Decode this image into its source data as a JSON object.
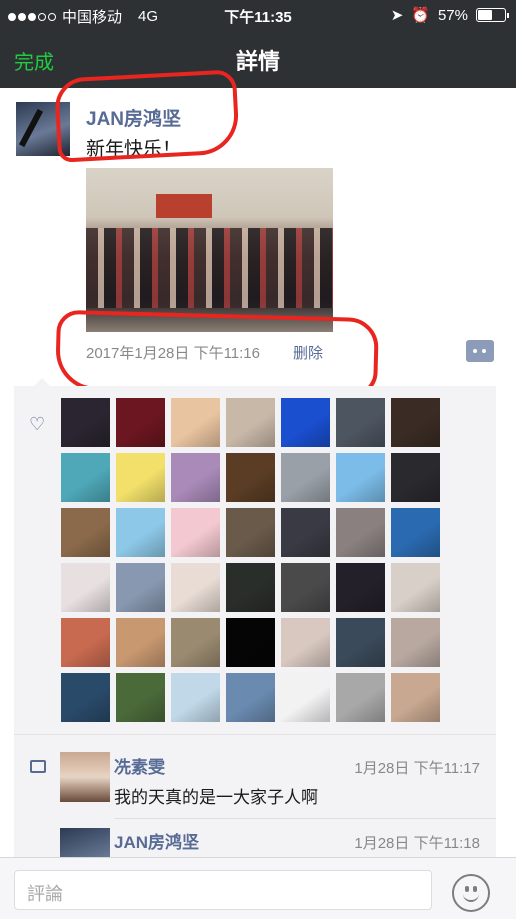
{
  "status_bar": {
    "carrier": "中国移动",
    "network": "4G",
    "time": "下午11:35",
    "battery": "57%",
    "battery_level": 0.57
  },
  "nav": {
    "done_label": "完成",
    "title": "詳情"
  },
  "post": {
    "author": "JAN房鸿坚",
    "text": "新年快乐！",
    "timestamp": "2017年1月28日 下午11:16",
    "delete_label": "删除"
  },
  "likes": {
    "icon": "heart-icon",
    "avatar_colors": [
      "#2a2530",
      "#6b1620",
      "#e9c4a0",
      "#c8b8a8",
      "#1a4fd0",
      "#4d5560",
      "#3a2c24",
      "#4ea8b8",
      "#f2e06a",
      "#a98ab8",
      "#5a3d24",
      "#9aa0a8",
      "#7bbce8",
      "#2a2a2e",
      "#8a6a4a",
      "#8dc8e8",
      "#f4c8d0",
      "#6a5a4a",
      "#3a3a44",
      "#8a8080",
      "#2a6ab0",
      "#e8e0e0",
      "#8898b0",
      "#e8dcd4",
      "#2a2e2a",
      "#4a4a4a",
      "#24202a",
      "#d8d0c8",
      "#c86a50",
      "#c89870",
      "#9a8a70",
      "#050505",
      "#d8c8c0",
      "#3a4a5a",
      "#b8a8a0",
      "#2a4a6a",
      "#4a6a3a",
      "#c0d8e8",
      "#6a8ab0",
      "#f2f2f2",
      "#a8a8a8",
      "#c8a890"
    ]
  },
  "comments": [
    {
      "name": "冼素雯",
      "time": "1月28日 下午11:17",
      "text": "我的天真的是一大家子人啊"
    },
    {
      "name": "JAN房鸿坚",
      "time": "1月28日 下午11:18",
      "text": ""
    }
  ],
  "input": {
    "placeholder": "評論"
  },
  "colors": {
    "nav_bg": "#2e3134",
    "accent_green": "#1fcc3f",
    "link_blue": "#576b95",
    "annotation_red": "#e8251e"
  }
}
